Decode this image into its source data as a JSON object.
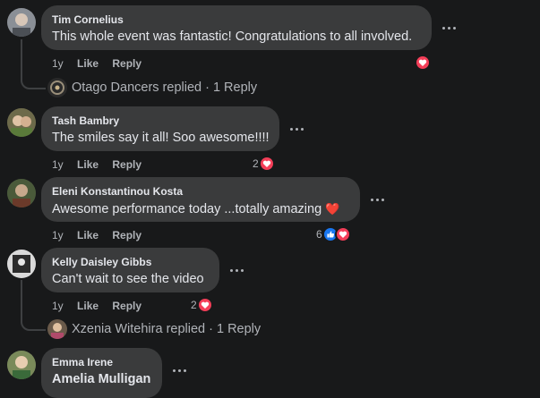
{
  "colors": {
    "background": "#18191a",
    "bubble": "#3a3b3c",
    "love": "#f33e58",
    "like": "#1877f2",
    "muted": "#b0b3b8"
  },
  "comments": [
    {
      "author": "Tim Cornelius",
      "text": "This whole event was fantastic! Congratulations to all involved.",
      "age": "1y",
      "like": "Like",
      "reply": "Reply",
      "reaction_count": "",
      "reactions": [
        "heart-icon"
      ]
    },
    {
      "author": "Tash Bambry",
      "text": "The smiles say it all! Soo awesome!!!!",
      "age": "1y",
      "like": "Like",
      "reply": "Reply",
      "reaction_count": "2",
      "reactions": [
        "heart-icon"
      ]
    },
    {
      "author": "Eleni Konstantinou Kosta",
      "text": "Awesome performance today ...totally amazing",
      "emoji": "❤️",
      "age": "1y",
      "like": "Like",
      "reply": "Reply",
      "reaction_count": "6",
      "reactions": [
        "thumbs-up-icon",
        "heart-icon"
      ]
    },
    {
      "author": "Kelly Daisley Gibbs",
      "text": "Can't wait to see the video",
      "age": "1y",
      "like": "Like",
      "reply": "Reply",
      "reaction_count": "2",
      "reactions": [
        "heart-icon"
      ]
    },
    {
      "author": "Emma Irene",
      "text": "Amelia Mulligan"
    }
  ],
  "replies": [
    {
      "text": "Otago Dancers replied · 1 Reply"
    },
    {
      "text": "Xzenia Witehira replied · 1 Reply"
    }
  ]
}
